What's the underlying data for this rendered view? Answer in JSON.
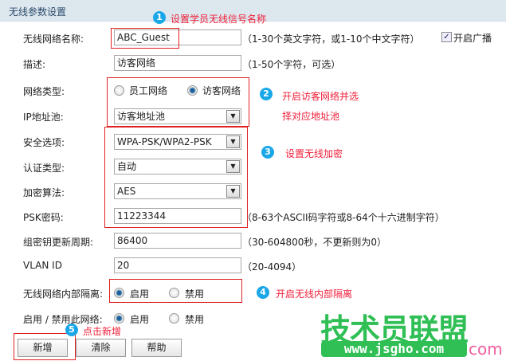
{
  "header": {
    "title": "无线参数设置"
  },
  "fields": {
    "ssid": {
      "label": "无线网络名称:",
      "value": "ABC_Guest",
      "hint": "（1-30个英文字符，或1-10个中文字符）"
    },
    "broadcast": {
      "label": "开启广播",
      "checked": true
    },
    "desc": {
      "label": "描述:",
      "value": "访客网络",
      "hint": "（1-50个字符，可选）"
    },
    "net_type": {
      "label": "网络类型:",
      "options": [
        "员工网络",
        "访客网络"
      ],
      "selected": "访客网络"
    },
    "ip_pool": {
      "label": "IP地址池:",
      "value": "访客地址池"
    },
    "security": {
      "label": "安全选项:",
      "value": "WPA-PSK/WPA2-PSK"
    },
    "auth": {
      "label": "认证类型:",
      "value": "自动"
    },
    "cipher": {
      "label": "加密算法:",
      "value": "AES"
    },
    "psk": {
      "label": "PSK密码:",
      "value": "11223344",
      "hint": "（8-63个ASCII码字符或8-64个十六进制字符）"
    },
    "rekey": {
      "label": "组密钥更新周期:",
      "value": "86400",
      "hint": "（30-604800秒，不更新则为0）"
    },
    "vlan": {
      "label": "VLAN ID",
      "value": "20",
      "hint": "（20-4094）"
    },
    "isolation": {
      "label": "无线网络内部隔离:",
      "options": [
        "启用",
        "禁用"
      ],
      "selected": "启用"
    },
    "enable": {
      "label": "启用 / 禁用此网络:",
      "options": [
        "启用",
        "禁用"
      ],
      "selected": "启用"
    }
  },
  "buttons": {
    "add": "新增",
    "clear": "清除",
    "help": "帮助"
  },
  "annotations": [
    {
      "num": "1",
      "text": "设置学员无线信号名称"
    },
    {
      "num": "2",
      "text": "开启访客网络并选",
      "text2": "择对应地址池"
    },
    {
      "num": "3",
      "text": "设置无线加密"
    },
    {
      "num": "4",
      "text": "开启无线内部隔离"
    },
    {
      "num": "5",
      "text": "点击新增"
    }
  ],
  "watermark": {
    "title": "技术员联盟",
    "url": "www.jsgho.com",
    "suffix": "com"
  }
}
